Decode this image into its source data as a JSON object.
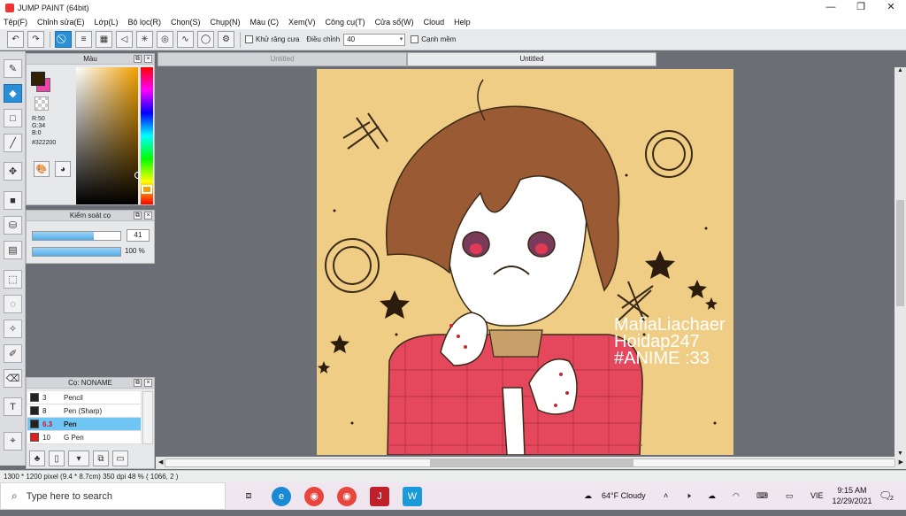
{
  "window": {
    "title": "JUMP PAINT (64bit)",
    "minimize": "—",
    "restore": "❐",
    "close": "✕"
  },
  "menu": [
    "Tệp(F)",
    "Chỉnh sửa(E)",
    "Lớp(L)",
    "Bộ lọc(R)",
    "Chọn(S)",
    "Chụp(N)",
    "Màu (C)",
    "Xem(V)",
    "Công cụ(T)",
    "Cửa sổ(W)",
    "Cloud",
    "Help"
  ],
  "toolbar": {
    "antialias_label": "Khử răng cưa",
    "adjust_label": "Điều chỉnh",
    "adjust_value": "40",
    "smooth_label": "Cạnh mềm"
  },
  "color_panel": {
    "title": "Màu",
    "r": "R:50",
    "g": "G:34",
    "b": "B:0",
    "hex": "#322200",
    "primary_color": "#322200",
    "secondary_color": "#ee44aa"
  },
  "brush_control": {
    "title": "Kiểm soát cọ",
    "size_value": "41",
    "size_fill": 0.7,
    "opacity_value": "100 %",
    "opacity_fill": 1.0
  },
  "brush_list": {
    "title": "Cọ: NONAME",
    "items": [
      {
        "size": "3",
        "name": "Pencil",
        "color": "#222222",
        "selected": false
      },
      {
        "size": "8",
        "name": "Pen (Sharp)",
        "color": "#222222",
        "selected": false
      },
      {
        "size": "6.3",
        "name": "Pen",
        "color": "#222222",
        "selected": true
      },
      {
        "size": "10",
        "name": "G Pen",
        "color": "#e02020",
        "selected": false
      }
    ]
  },
  "doc_tabs": [
    "Untitled",
    "Untitled"
  ],
  "artwork": {
    "watermark_line1": "MafiaLiachaer",
    "watermark_line2": "Hoidap247",
    "watermark_line3": "#ANIME :33",
    "bg_color": "#f0cd84"
  },
  "status": {
    "text": "1300 * 1200 pixel  (9.4 * 8.7cm)  350 dpi  48 %  ( 1066, 2 )"
  },
  "taskbar": {
    "search_placeholder": "Type here to search",
    "weather": "64°F  Cloudy",
    "language": "VIE",
    "time": "9:15 AM",
    "date": "12/29/2021",
    "notif_count": "2"
  }
}
